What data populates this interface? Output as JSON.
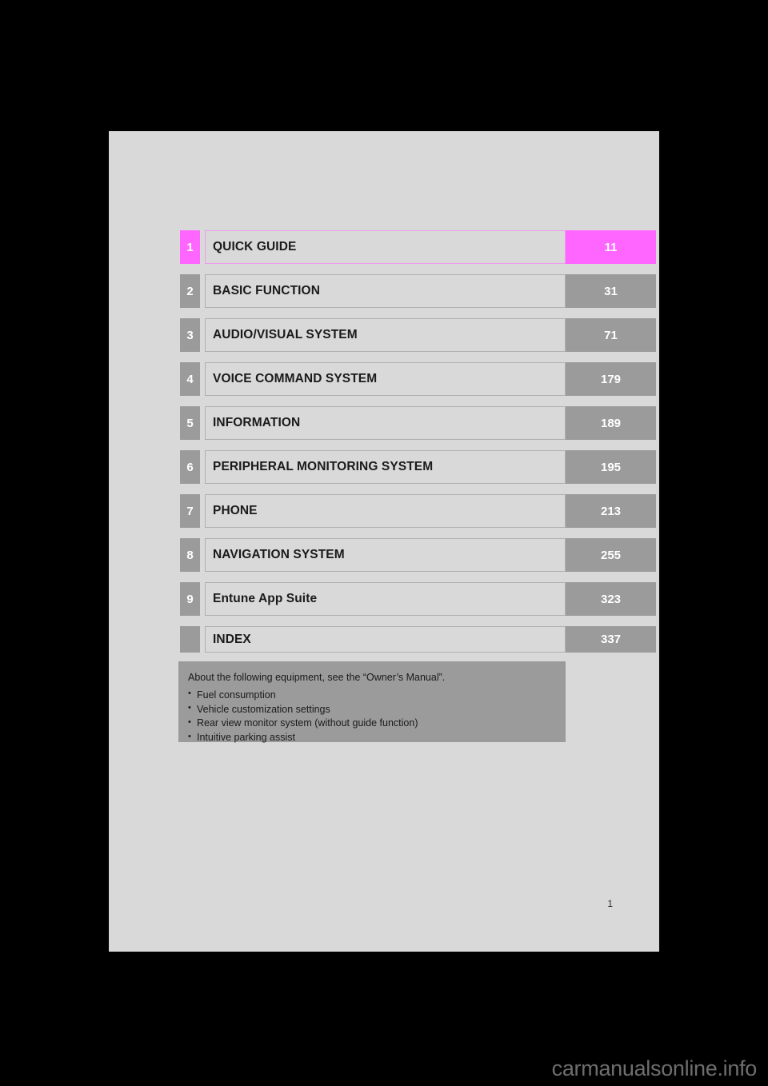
{
  "document": {
    "folio": "1",
    "watermark": "carmanualsonline.info"
  },
  "colors": {
    "accent": "#ff66ff",
    "chip_gray": "#9b9b9b",
    "plate_gray": "#d9d9d9",
    "page_background": "#d9d9d9",
    "canvas": "#000000"
  },
  "toc": {
    "rows": [
      {
        "number": "1",
        "title": "QUICK GUIDE",
        "page": "11",
        "accent": true,
        "case": "upper"
      },
      {
        "number": "2",
        "title": "BASIC FUNCTION",
        "page": "31",
        "accent": false,
        "case": "upper"
      },
      {
        "number": "3",
        "title": "AUDIO/VISUAL SYSTEM",
        "page": "71",
        "accent": false,
        "case": "upper"
      },
      {
        "number": "4",
        "title": "VOICE COMMAND SYSTEM",
        "page": "179",
        "accent": false,
        "case": "upper"
      },
      {
        "number": "5",
        "title": "INFORMATION",
        "page": "189",
        "accent": false,
        "case": "upper"
      },
      {
        "number": "6",
        "title": "PERIPHERAL MONITORING SYSTEM",
        "page": "195",
        "accent": false,
        "case": "upper"
      },
      {
        "number": "7",
        "title": "PHONE",
        "page": "213",
        "accent": false,
        "case": "upper"
      },
      {
        "number": "8",
        "title": "NAVIGATION SYSTEM",
        "page": "255",
        "accent": false,
        "case": "upper"
      },
      {
        "number": "9",
        "title": "Entune App Suite",
        "page": "323",
        "accent": false,
        "case": "mixed"
      },
      {
        "number": "",
        "title": "INDEX",
        "page": "337",
        "accent": false,
        "case": "upper"
      }
    ]
  },
  "note": {
    "lead": "About the following equipment, see the “Owner’s Manual”.",
    "items": [
      "Fuel consumption",
      "Vehicle customization settings",
      "Rear view monitor system (without guide function)",
      "Intuitive parking assist"
    ]
  }
}
